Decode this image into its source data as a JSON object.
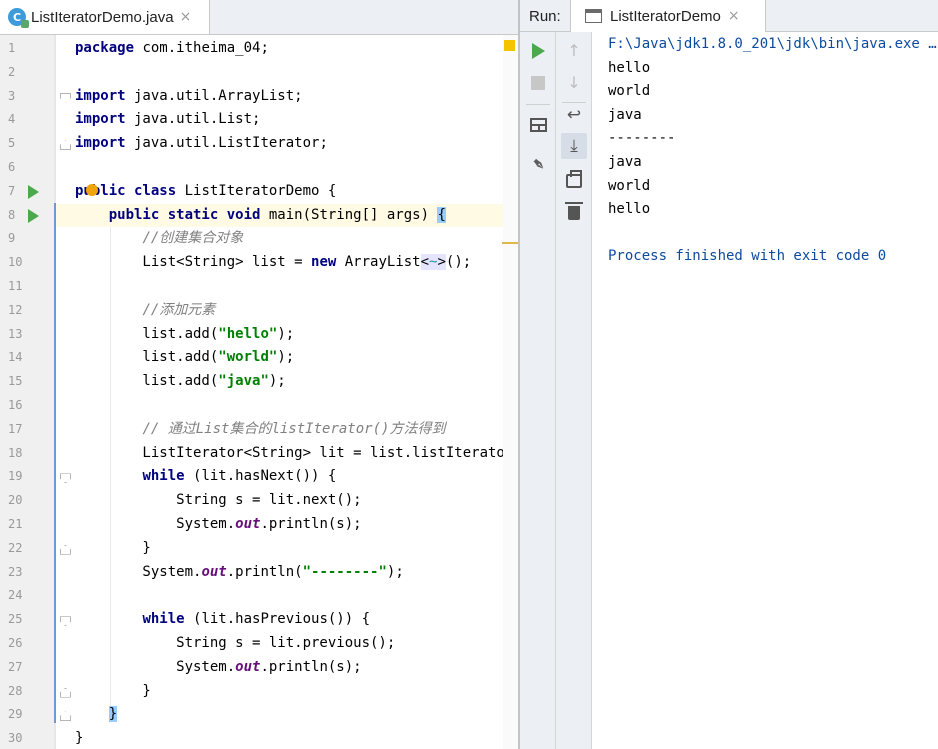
{
  "editor": {
    "tab": {
      "icon": "java-class-icon",
      "label": "ListIteratorDemo.java",
      "close": "×"
    },
    "lines": [
      {
        "n": "1",
        "html": "<span class=\"kw\">package</span> com.itheima_04;"
      },
      {
        "n": "2",
        "html": ""
      },
      {
        "n": "3",
        "html": "<span class=\"kw\">import</span> java.util.ArrayList;"
      },
      {
        "n": "4",
        "html": "<span class=\"kw\">import</span> java.util.List;"
      },
      {
        "n": "5",
        "html": "<span class=\"kw\">import</span> java.util.ListIterator;"
      },
      {
        "n": "6",
        "html": ""
      },
      {
        "n": "7",
        "html": "<span class=\"kw\">public class</span> ListIteratorDemo {"
      },
      {
        "n": "8",
        "html": "    <span class=\"kw\">public static void</span> main(String[] args) <span class=\"brace-hl\">{</span>"
      },
      {
        "n": "9",
        "html": "        <span class=\"cmt\">//创建集合对象</span>"
      },
      {
        "n": "10",
        "html": "        List&lt;String&gt; list = <span class=\"kw\">new</span> ArrayList<span class=\"diamond-hl\">&lt;<span class=\"gen\">~</span>&gt;</span>();"
      },
      {
        "n": "11",
        "html": ""
      },
      {
        "n": "12",
        "html": "        <span class=\"cmt\">//添加元素</span>"
      },
      {
        "n": "13",
        "html": "        list.add(<span class=\"str\">\"hello\"</span>);"
      },
      {
        "n": "14",
        "html": "        list.add(<span class=\"str\">\"world\"</span>);"
      },
      {
        "n": "15",
        "html": "        list.add(<span class=\"str\">\"java\"</span>);"
      },
      {
        "n": "16",
        "html": ""
      },
      {
        "n": "17",
        "html": "        <span class=\"cmt\">// 通过List集合的listIterator()方法得到</span>"
      },
      {
        "n": "18",
        "html": "        ListIterator&lt;String&gt; lit = list.listIterator();"
      },
      {
        "n": "19",
        "html": "        <span class=\"kw\">while</span> (lit.hasNext()) {"
      },
      {
        "n": "20",
        "html": "            String s = lit.next();"
      },
      {
        "n": "21",
        "html": "            System.<span class=\"fld\">out</span>.println(s);"
      },
      {
        "n": "22",
        "html": "        }"
      },
      {
        "n": "23",
        "html": "        System.<span class=\"fld\">out</span>.println(<span class=\"str\">\"--------\"</span>);"
      },
      {
        "n": "24",
        "html": ""
      },
      {
        "n": "25",
        "html": "        <span class=\"kw\">while</span> (lit.hasPrevious()) {"
      },
      {
        "n": "26",
        "html": "            String s = lit.previous();"
      },
      {
        "n": "27",
        "html": "            System.<span class=\"fld\">out</span>.println(s);"
      },
      {
        "n": "28",
        "html": "        }"
      },
      {
        "n": "29",
        "html": "    <span class=\"brace-hl\">}</span>"
      },
      {
        "n": "30",
        "html": "}"
      }
    ],
    "run_gutter_lines": [
      7,
      8
    ],
    "fold_open_lines": [
      3,
      8,
      19,
      25
    ],
    "fold_close_lines": [
      5,
      22,
      28,
      29
    ],
    "current_line": 8
  },
  "run": {
    "title": "Run:",
    "tab_label": "ListIteratorDemo",
    "tab_close": "×",
    "console": [
      {
        "text": "F:\\Java\\jdk1.8.0_201\\jdk\\bin\\java.exe ...",
        "kind": "cmd"
      },
      {
        "text": "hello",
        "kind": "out"
      },
      {
        "text": "world",
        "kind": "out"
      },
      {
        "text": "java",
        "kind": "out"
      },
      {
        "text": "--------",
        "kind": "out"
      },
      {
        "text": "java",
        "kind": "out"
      },
      {
        "text": "world",
        "kind": "out"
      },
      {
        "text": "hello",
        "kind": "out"
      },
      {
        "text": "",
        "kind": "out"
      },
      {
        "text": "Process finished with exit code 0",
        "kind": "exit"
      }
    ]
  },
  "icons": {
    "rerun": "rerun-icon",
    "stop": "stop-icon",
    "layout": "layout-icon",
    "pin": "pin-icon",
    "up": "up-arrow-icon",
    "down": "down-arrow-icon",
    "wrap": "soft-wrap-icon",
    "scroll": "scroll-to-end-icon",
    "print": "print-icon",
    "trash": "clear-all-icon"
  },
  "colors": {
    "keyword": "#000080",
    "string": "#008000",
    "comment": "#808080",
    "run_green": "#4ca84c",
    "console_blue": "#0b4a9e"
  }
}
